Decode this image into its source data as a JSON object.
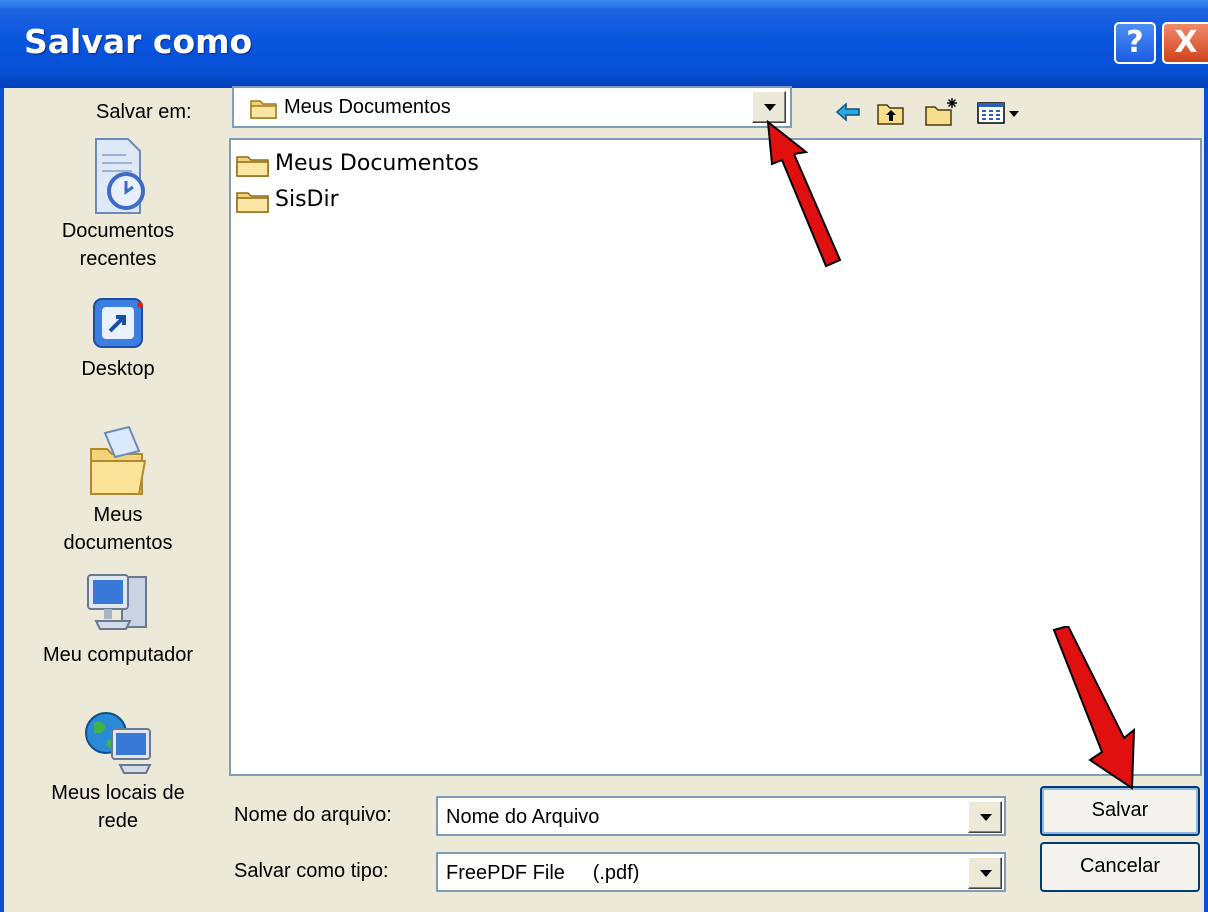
{
  "dialog": {
    "title": "Salvar como",
    "help_button": "?",
    "close_button": "X"
  },
  "look_in": {
    "label": "Salvar em:",
    "value": "Meus Documentos"
  },
  "toolbar": {
    "icons": [
      "back-arrow-icon",
      "up-folder-icon",
      "new-folder-icon",
      "view-menu-icon"
    ]
  },
  "places_bar": [
    {
      "label_line1": "Documentos",
      "label_line2": "recentes",
      "icon": "recent-documents-icon"
    },
    {
      "label_line1": "Desktop",
      "label_line2": "",
      "icon": "desktop-icon"
    },
    {
      "label_line1": "Meus",
      "label_line2": "documentos",
      "icon": "my-documents-icon"
    },
    {
      "label_line1": "Meu computador",
      "label_line2": "",
      "icon": "my-computer-icon"
    },
    {
      "label_line1": "Meus locais de",
      "label_line2": "rede",
      "icon": "network-places-icon"
    }
  ],
  "file_list": [
    {
      "name": "Meus Documentos",
      "icon": "folder-icon"
    },
    {
      "name": "SisDir",
      "icon": "folder-icon"
    }
  ],
  "filename": {
    "label": "Nome do arquivo:",
    "value": "Nome do Arquivo"
  },
  "filetype": {
    "label": "Salvar como tipo:",
    "value": "FreePDF File     (.pdf)"
  },
  "buttons": {
    "save": "Salvar",
    "cancel": "Cancelar"
  },
  "annotations": {
    "arrow_color": "#e01010"
  },
  "colors": {
    "title_bar": "#0a55de",
    "dialog_bg": "#ece9d8",
    "field_border": "#7f9db9"
  }
}
